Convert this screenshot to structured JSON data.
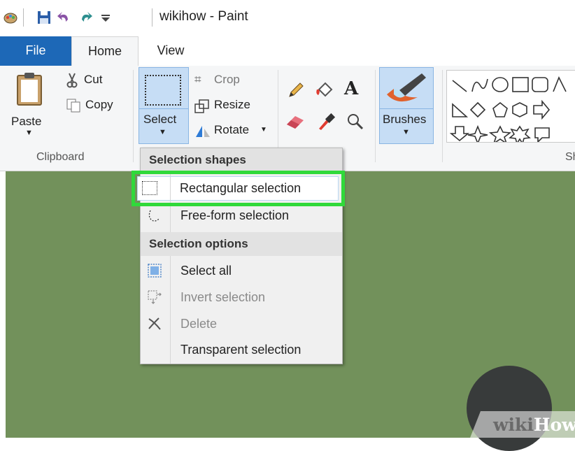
{
  "window": {
    "title": "wikihow - Paint"
  },
  "quick_access": [
    "paint-app-icon",
    "save-icon",
    "undo-icon",
    "redo-icon",
    "customize-arrow-icon"
  ],
  "tabs": {
    "file": "File",
    "home": "Home",
    "view": "View"
  },
  "clipboard": {
    "paste": "Paste",
    "cut": "Cut",
    "copy": "Copy",
    "group": "Clipboard"
  },
  "image": {
    "select": "Select",
    "crop": "Crop",
    "resize": "Resize",
    "rotate": "Rotate"
  },
  "tools": [
    "pencil-icon",
    "fill-icon",
    "text-icon",
    "eraser-icon",
    "color-picker-icon",
    "magnifier-icon"
  ],
  "brushes": {
    "label": "Brushes"
  },
  "shapes": {
    "group": "Sh"
  },
  "dropdown": {
    "header1": "Selection shapes",
    "rect": "Rectangular selection",
    "free": "Free-form selection",
    "header2": "Selection options",
    "select_all": "Select all",
    "invert": "Invert selection",
    "delete": "Delete",
    "transparent": "Transparent selection"
  },
  "watermark": {
    "wiki": "wiki",
    "how": "How"
  },
  "colors": {
    "file_tab": "#1d68b7",
    "canvas": "#72915b",
    "highlight": "#30d93a",
    "ribbon": "#f5f6f7"
  }
}
